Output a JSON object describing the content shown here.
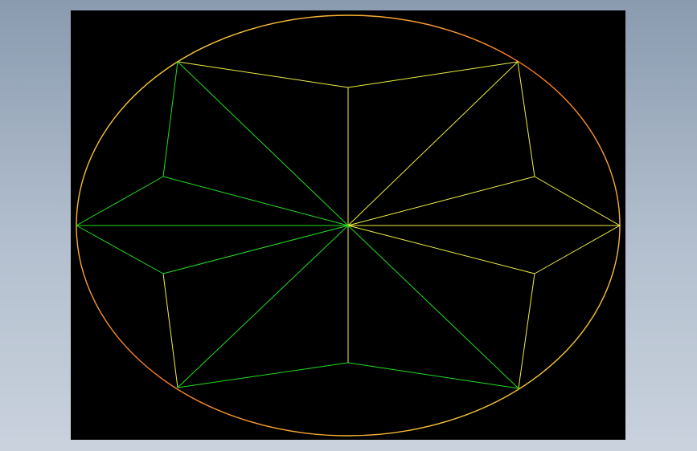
{
  "scene": {
    "background_color": "#000000",
    "window_gradient": [
      "#8a9bb0",
      "#c9d2dd"
    ],
    "colors": {
      "green": "#22dd22",
      "yellow": "#eeee44",
      "orange": "#ff7a22"
    },
    "shape": "eight-point star facets inscribed in an ellipse"
  }
}
